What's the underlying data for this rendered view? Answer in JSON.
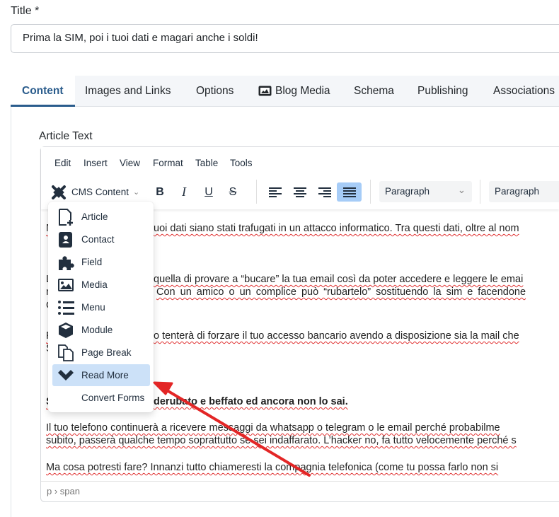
{
  "title": {
    "label": "Title *",
    "value": "Prima la SIM, poi i tuoi dati e magari anche i soldi!"
  },
  "tabs": [
    {
      "label": "Content",
      "active": true
    },
    {
      "label": "Images and Links"
    },
    {
      "label": "Options"
    },
    {
      "label": "Blog Media",
      "icon": "image-icon"
    },
    {
      "label": "Schema"
    },
    {
      "label": "Publishing"
    },
    {
      "label": "Associations"
    }
  ],
  "editor": {
    "label": "Article Text",
    "menubar": [
      "Edit",
      "Insert",
      "View",
      "Format",
      "Table",
      "Tools"
    ],
    "toolbar": {
      "cms_content": "CMS Content",
      "block_format": "Paragraph",
      "font_format": "Paragraph",
      "active_align": "justify"
    },
    "content": {
      "l1a": "N",
      "l1b": "uoi dati siano stati trafugati in un attacco informatico. Tra questi dati, oltre al nom",
      "l2a": "L",
      "l2b": "quella di provare a “bucare” la tua email così da poter accedere e leggere le emai",
      "l3a": "n",
      "l3b": "Con un amico o un complice può “rubartelo” sostituendo la sim e facendone",
      "l4a": "G",
      "l5a": "P",
      "l5b": "o tenterà di forzare il tuo accesso bancario avendo a disposizione sia la mail che",
      "l6a": "S",
      "l7a": "S",
      "l7b": "derubato e beffato ed ancora non lo sai.",
      "l8": "Il tuo telefono continuerà a ricevere messaggi da whatsapp o telegram o le email perché probabilme",
      "l9": "subito, passerà qualche tempo soprattutto se sei indaffarato. L’hacker no, fa tutto velocemente perché s",
      "l10": "Ma cosa potresti fare? Innanzi tutto chiameresti la compagnia telefonica (come tu possa farlo non si"
    },
    "statusbar": "p › span"
  },
  "dropdown": {
    "items": [
      {
        "label": "Article",
        "icon": "file-plus-icon"
      },
      {
        "label": "Contact",
        "icon": "address-book-icon"
      },
      {
        "label": "Field",
        "icon": "puzzle-icon"
      },
      {
        "label": "Media",
        "icon": "image-icon"
      },
      {
        "label": "Menu",
        "icon": "list-icon"
      },
      {
        "label": "Module",
        "icon": "cube-icon"
      },
      {
        "label": "Page Break",
        "icon": "copy-icon"
      },
      {
        "label": "Read More",
        "icon": "chevron-down-icon",
        "highlighted": true
      },
      {
        "label": "Convert Forms"
      }
    ]
  },
  "colors": {
    "accent": "#2a5c8c",
    "highlight": "#cce1f8",
    "annotation_arrow": "#e32626"
  }
}
